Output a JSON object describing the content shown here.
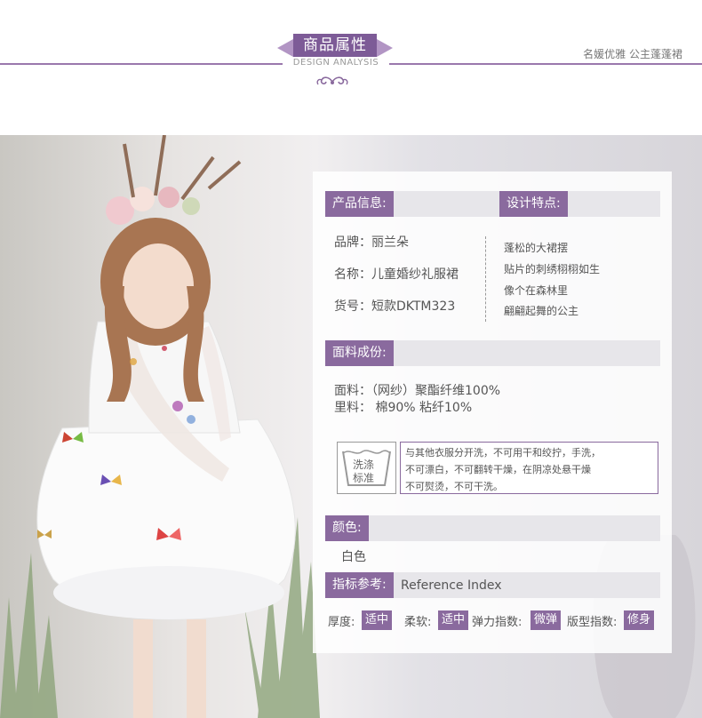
{
  "header": {
    "title": "商品属性",
    "subtitle": "DESIGN ANALYSIS",
    "slogan": "名媛优雅  公主蓬蓬裙"
  },
  "colors": {
    "accent": "#8a6a9e",
    "band": "#9a78ad",
    "bar_bg": "#e7e6ea"
  },
  "product_info": {
    "heading": "产品信息:",
    "items": [
      {
        "label": "品牌：",
        "value": "丽兰朵"
      },
      {
        "label": "名称：",
        "value": "儿童婚纱礼服裙"
      },
      {
        "label": "货号：",
        "value": "短款DKTM323"
      }
    ]
  },
  "design": {
    "heading": "设计特点:",
    "items": [
      "蓬松的大裙摆",
      "贴片的刺绣栩栩如生",
      "像个在森林里",
      "翩翩起舞的公主"
    ]
  },
  "fabric": {
    "heading": "面料成份:",
    "lines": [
      "面料：（网纱）聚酯纤维100%",
      "里料： 棉90% 粘纤10%"
    ]
  },
  "wash": {
    "icon_text": [
      "洗涤",
      "标准"
    ],
    "icon": "wash-basin-icon",
    "lines": [
      "与其他衣服分开洗，不可用干和绞拧，手洗，",
      "不可漂白，不可翻转干燥，在阴凉处悬干燥",
      "不可熨烫，不可干洗。"
    ]
  },
  "color_section": {
    "heading": "颜色:",
    "value": "白色"
  },
  "reference": {
    "heading": "指标参考:",
    "subtitle": "Reference Index",
    "items": [
      {
        "label": "厚度:",
        "value": "适中"
      },
      {
        "label": "柔软:",
        "value": "适中"
      },
      {
        "label": "弹力指数:",
        "value": "微弹"
      },
      {
        "label": "版型指数:",
        "value": "修身"
      }
    ]
  }
}
